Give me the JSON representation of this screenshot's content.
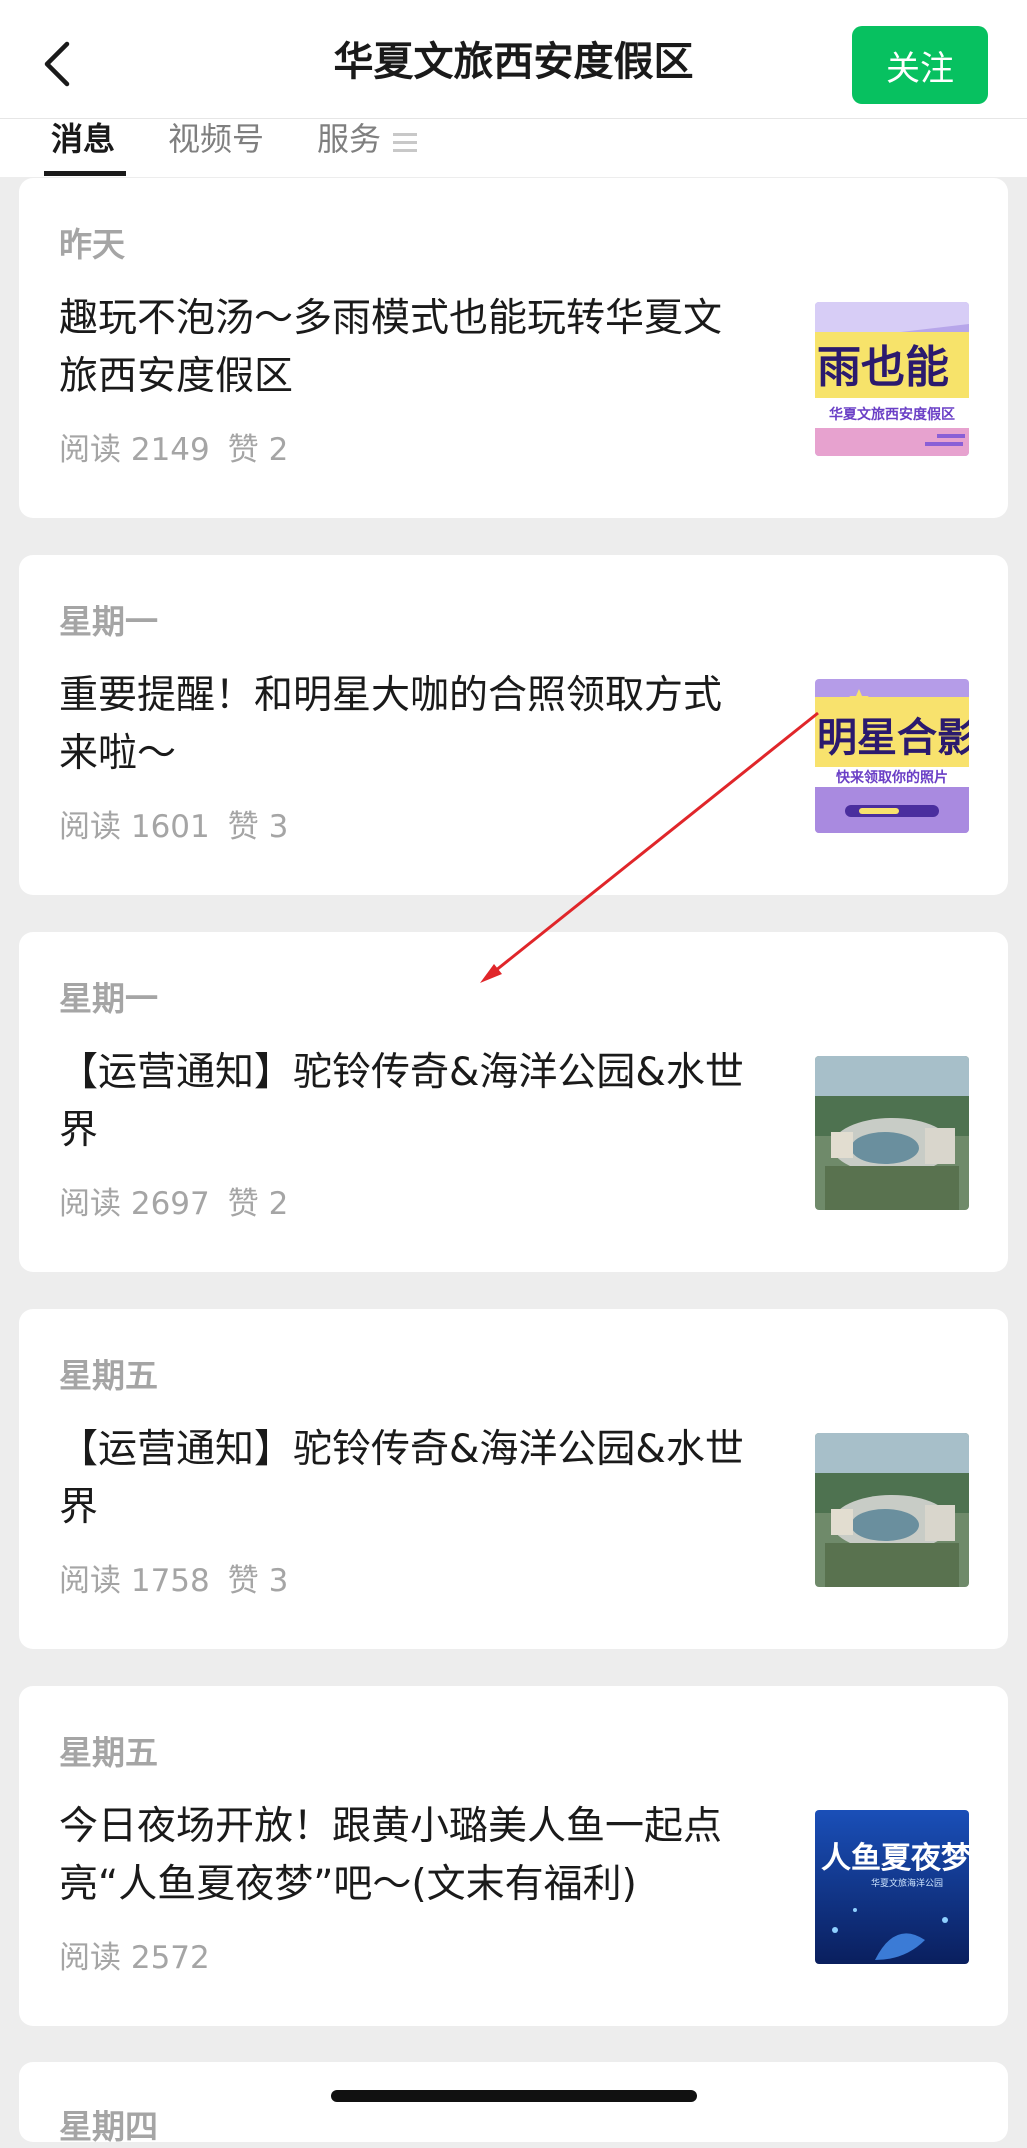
{
  "header": {
    "title": "华夏文旅西安度假区",
    "follow_label": "关注",
    "back_icon": "chevron-left-icon"
  },
  "tabs": [
    {
      "label": "消息",
      "active": true
    },
    {
      "label": "视频号",
      "active": false
    },
    {
      "label": "服务",
      "active": false
    }
  ],
  "tab_menu_icon": "menu-icon",
  "articles": [
    {
      "date": "昨天",
      "title_line1": "趣玩不泡汤～多雨模式也能玩转华夏文",
      "title_line2": "旅西安度假区",
      "reads": "阅读 2149",
      "likes": "赞 2",
      "thumb_text": "雨也能",
      "thumb_subtext": "华夏文旅西安度假区"
    },
    {
      "date": "星期一",
      "title_line1": "重要提醒！和明星大咖的合照领取方式",
      "title_line2": "来啦～",
      "reads": "阅读 1601",
      "likes": "赞 3",
      "thumb_text": "明星合影",
      "thumb_subtext": "快来领取你的照片"
    },
    {
      "date": "星期一",
      "title_line1": "【运营通知】驼铃传奇&海洋公园&水世",
      "title_line2": "界",
      "reads": "阅读 2697",
      "likes": "赞 2"
    },
    {
      "date": "星期五",
      "title_line1": "【运营通知】驼铃传奇&海洋公园&水世",
      "title_line2": "界",
      "reads": "阅读 1758",
      "likes": "赞 3"
    },
    {
      "date": "星期五",
      "title_line1": "今日夜场开放！跟黄小璐美人鱼一起点",
      "title_line2": "亮“人鱼夏夜梦”吧～(文末有福利)",
      "reads": "阅读 2572",
      "likes": "",
      "thumb_text": "人鱼夏夜梦",
      "thumb_subtext": "华夏文旅海洋公园"
    }
  ],
  "partial_article": {
    "date": "星期四"
  },
  "colors": {
    "accent": "#07c160",
    "background": "#ededed",
    "annotation_arrow": "#e0262a"
  }
}
